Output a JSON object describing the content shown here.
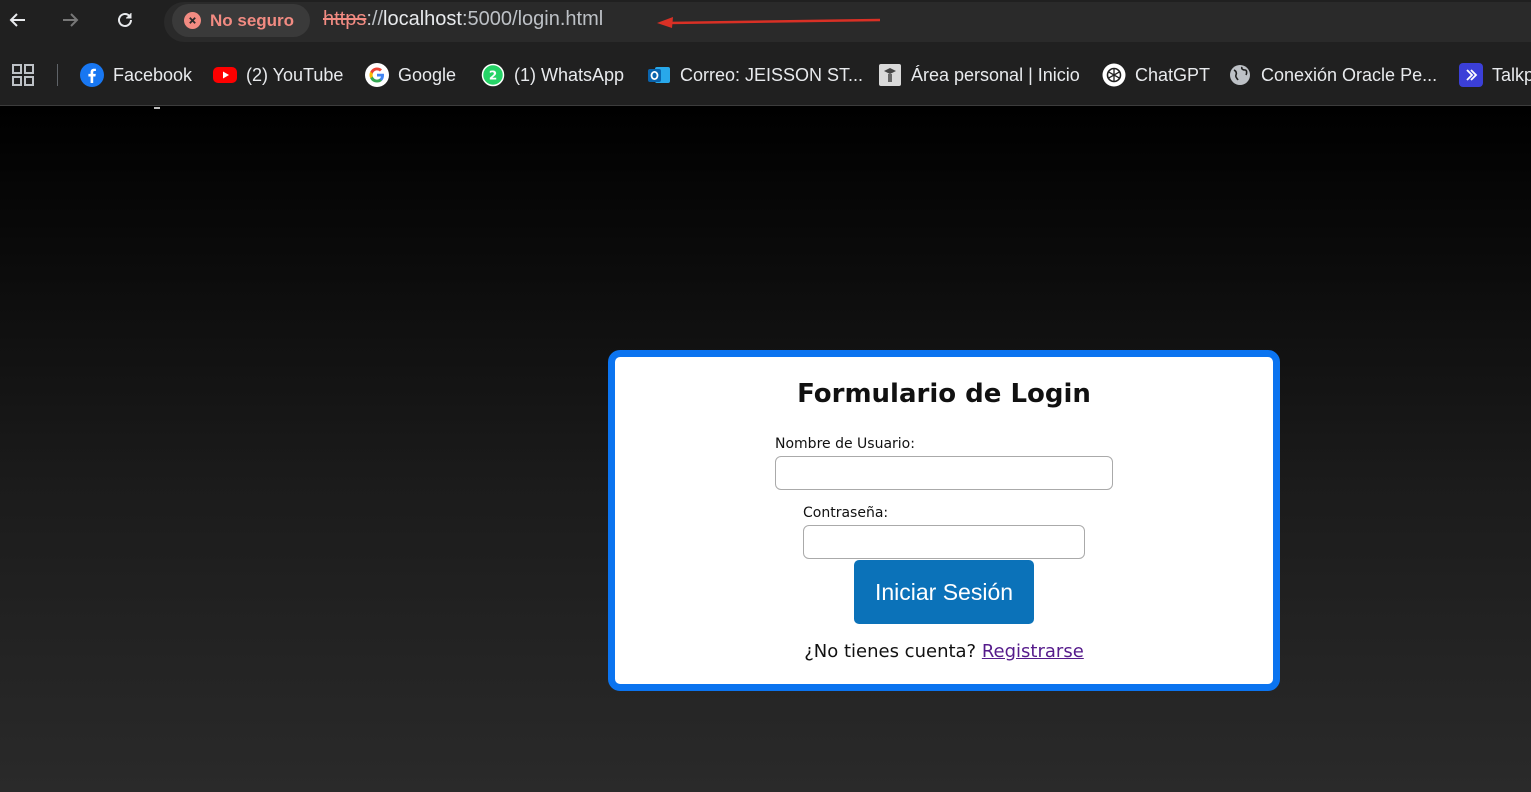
{
  "browser": {
    "security_label": "No seguro",
    "url_scheme": "https",
    "url_sep": "://",
    "url_host": "localhost",
    "url_path": ":5000/login.html",
    "annotation_arrow_color": "#d93025"
  },
  "bookmarks": [
    {
      "label": "Facebook",
      "icon": "facebook-icon"
    },
    {
      "label": "(2) YouTube",
      "icon": "youtube-icon"
    },
    {
      "label": "Google",
      "icon": "google-icon"
    },
    {
      "label": "(1) WhatsApp",
      "icon": "whatsapp-icon"
    },
    {
      "label": "Correo: JEISSON ST...",
      "icon": "outlook-icon"
    },
    {
      "label": "Área personal | Inicio",
      "icon": "moodle-icon"
    },
    {
      "label": "ChatGPT",
      "icon": "chatgpt-icon"
    },
    {
      "label": "Conexión Oracle Pe...",
      "icon": "globe-icon"
    },
    {
      "label": "Talkp",
      "icon": "talkpal-icon"
    }
  ],
  "login": {
    "title": "Formulario de Login",
    "username_label": "Nombre de Usuario:",
    "username_value": "",
    "password_label": "Contraseña:",
    "password_value": "",
    "submit_label": "Iniciar Sesión",
    "signup_prompt": "¿No tienes cuenta?",
    "signup_link": "Registrarse"
  },
  "colors": {
    "card_border": "#0b74f0",
    "button_bg": "#0b72b9",
    "insecure": "#f28b82"
  }
}
